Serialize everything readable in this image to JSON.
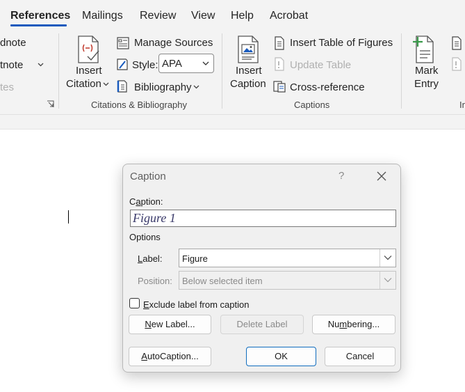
{
  "tabs": [
    {
      "label": "References",
      "active": true
    },
    {
      "label": "Mailings"
    },
    {
      "label": "Review"
    },
    {
      "label": "View"
    },
    {
      "label": "Help"
    },
    {
      "label": "Acrobat"
    }
  ],
  "ribbon": {
    "footnotes": {
      "item1": "dnote",
      "item2": "tnote",
      "item3": "tes"
    },
    "citations": {
      "insert_citation_line1": "Insert",
      "insert_citation_line2": "Citation",
      "manage_sources": "Manage Sources",
      "style_label": "Style:",
      "style_value": "APA",
      "bibliography": "Bibliography",
      "group_name": "Citations & Bibliography"
    },
    "captions": {
      "insert_caption_line1": "Insert",
      "insert_caption_line2": "Caption",
      "insert_table_of_figures": "Insert Table of Figures",
      "update_table": "Update Table",
      "cross_reference": "Cross-reference",
      "group_name": "Captions"
    },
    "index": {
      "mark_entry_line1": "Mark",
      "mark_entry_line2": "Entry",
      "group_name_partial": "In"
    }
  },
  "dialog": {
    "title": "Caption",
    "help_glyph": "?",
    "caption_label_prefix": "C",
    "caption_label_underlined": "a",
    "caption_label_rest": "ption:",
    "caption_value": "Figure 1",
    "options_heading": "Options",
    "label_field_prefix": "",
    "label_field_underlined": "L",
    "label_field_rest": "abel:",
    "label_value": "Figure",
    "position_label": "Position:",
    "position_value": "Below selected item",
    "exclude_prefix": "",
    "exclude_underlined": "E",
    "exclude_rest": "xclude label from caption",
    "exclude_checked": false,
    "new_label_prefix": "",
    "new_label_underlined": "N",
    "new_label_rest": "ew Label...",
    "delete_label": "Delete Label",
    "numbering_prefix": "Nu",
    "numbering_underlined": "m",
    "numbering_rest": "bering...",
    "autocaption_prefix": "",
    "autocaption_underlined": "A",
    "autocaption_rest": "utoCaption...",
    "ok_label": "OK",
    "cancel_label": "Cancel"
  },
  "colors": {
    "accent": "#185abd",
    "ribbon_bg": "#f3f3f3",
    "dialog_bg": "#f0f0f0",
    "citation_icon_red": "#c0392b",
    "mark_entry_green": "#3a9a4a",
    "ok_border": "#0f6cbd"
  }
}
